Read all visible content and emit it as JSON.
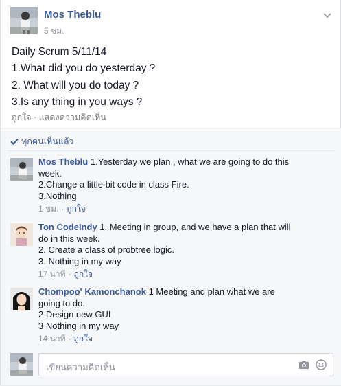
{
  "post": {
    "author": "Mos Theblu",
    "time": "5 ชม.",
    "lines": [
      "Daily Scrum 5/11/14",
      "1.What did you do yesterday ?",
      "2. What will you do today ?",
      "3.Is any thing in you ways ?"
    ],
    "actions": {
      "like": "ถูกใจ",
      "sep": "·",
      "comment": "แสดงความคิดเห็น"
    }
  },
  "seen": {
    "label": "ทุกคนเห็นแล้ว"
  },
  "comments": [
    {
      "name": "Mos Theblu",
      "first_line": "1.Yesterday we plan , what we are going to do this",
      "lines": [
        "week.",
        "2.Change a little bit code in class Fire.",
        "3.Nothing"
      ],
      "time": "1 ชม.",
      "dot": "·",
      "like": "ถูกใจ"
    },
    {
      "name": "Ton CodeIndy",
      "first_line": "1. Meeting in group, and we have a plan that will",
      "lines": [
        "do in this week.",
        "2. Create a class of probtree logic.",
        "3. Nothing in my way"
      ],
      "time": "17 นาที",
      "dot": "·",
      "like": "ถูกใจ"
    },
    {
      "name": "Chompoo' Kamonchanok",
      "first_line": "1 Meeting and plan what we are",
      "lines": [
        "going to do.",
        "2 Design new GUI",
        "3 Nothing in my way"
      ],
      "time": "14 นาที",
      "dot": "·",
      "like": "ถูกใจ"
    }
  ],
  "reply": {
    "placeholder": "เขียนความคิดเห็น"
  },
  "icons": {
    "chevron": "chevron-down-icon",
    "check": "check-icon",
    "camera": "camera-icon",
    "emoji": "emoji-icon"
  },
  "colors": {
    "link": "#3b5998",
    "meta": "#90949c",
    "text": "#141823"
  }
}
